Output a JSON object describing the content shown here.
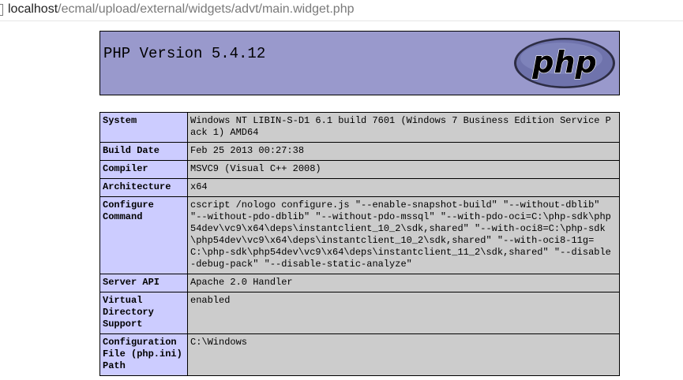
{
  "browser": {
    "url_host": "localhost",
    "url_path": "/ecmal/upload/external/widgets/advt/main.widget.php"
  },
  "header": {
    "title": "PHP Version 5.4.12",
    "logo_text": "php",
    "logo_colors": {
      "fill": "#6f73ac",
      "outline": "#2d2d44",
      "text": "#000000",
      "background": "#9999cc"
    }
  },
  "info_rows": [
    {
      "label": "System",
      "value": "Windows NT LIBIN-S-D1 6.1 build 7601 (Windows 7 Business Edition Service Pack 1) AMD64"
    },
    {
      "label": "Build Date",
      "value": "Feb 25 2013 00:27:38"
    },
    {
      "label": "Compiler",
      "value": "MSVC9 (Visual C++ 2008)"
    },
    {
      "label": "Architecture",
      "value": "x64"
    },
    {
      "label": "Configure Command",
      "value": "cscript /nologo configure.js \"--enable-snapshot-build\" \"--without-dblib\" \"--without-pdo-dblib\" \"--without-pdo-mssql\" \"--with-pdo-oci=C:\\php-sdk\\php54dev\\vc9\\x64\\deps\\instantclient_10_2\\sdk,shared\" \"--with-oci8=C:\\php-sdk\\php54dev\\vc9\\x64\\deps\\instantclient_10_2\\sdk,shared\" \"--with-oci8-11g=C:\\php-sdk\\php54dev\\vc9\\x64\\deps\\instantclient_11_2\\sdk,shared\" \"--disable-debug-pack\" \"--disable-static-analyze\""
    },
    {
      "label": "Server API",
      "value": "Apache 2.0 Handler"
    },
    {
      "label": "Virtual Directory Support",
      "value": "enabled"
    },
    {
      "label": "Configuration File (php.ini) Path",
      "value": "C:\\Windows"
    }
  ],
  "colors": {
    "header_bg": "#9999cc",
    "label_bg": "#ccccff",
    "value_bg": "#cccccc"
  }
}
